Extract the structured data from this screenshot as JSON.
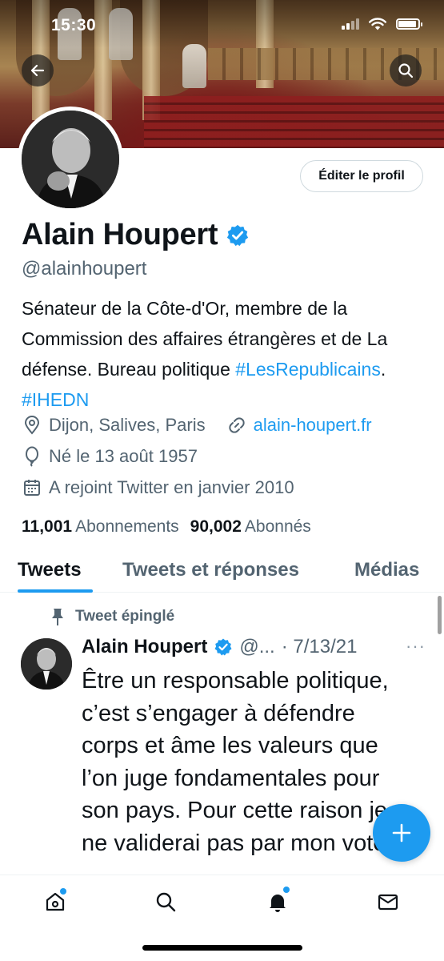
{
  "status_bar": {
    "time": "15:30"
  },
  "profile": {
    "name": "Alain Houpert",
    "handle": "@alainhoupert",
    "edit_button": "Éditer le profil",
    "bio_text": "Sénateur de la Côte-d'Or, membre de la Commission des affaires étrangères et de La défense. Bureau politique ",
    "bio_tag1": "#LesRepublicains",
    "bio_sep": ". ",
    "bio_tag2": "#IHEDN",
    "location": "Dijon, Salives, Paris",
    "website": "alain-houpert.fr",
    "birthday": "Né le 13 août 1957",
    "joined": "A rejoint Twitter en janvier 2010",
    "following_count": "11,001",
    "following_label": "Abonnements",
    "followers_count": "90,002",
    "followers_label": "Abonnés"
  },
  "tabs": [
    {
      "label": "Tweets"
    },
    {
      "label": "Tweets et réponses"
    },
    {
      "label": "Médias"
    }
  ],
  "tweet": {
    "pinned_label": "Tweet épinglé",
    "author": "Alain Houpert",
    "handle": "@...",
    "date": "· 7/13/21",
    "more": "···",
    "text": "Être un responsable politique, c’est s’engager à défendre corps et âme les valeurs que l’on juge fondamentales pour son pays. Pour cette raison je ne validerai pas par mon vote"
  },
  "colors": {
    "accent": "#1d9bf0",
    "secondary_text": "#536471",
    "verified": "#1d9bf0"
  },
  "icons": {
    "back": "arrow-left-icon",
    "search": "search-icon",
    "verified": "verified-badge-icon",
    "location": "location-pin-icon",
    "link": "link-icon",
    "birthday": "balloon-icon",
    "calendar": "calendar-icon",
    "pin": "pin-icon",
    "compose": "plus-icon",
    "home": "home-icon",
    "explore": "search-icon",
    "notifications": "bell-icon",
    "messages": "mail-icon"
  }
}
